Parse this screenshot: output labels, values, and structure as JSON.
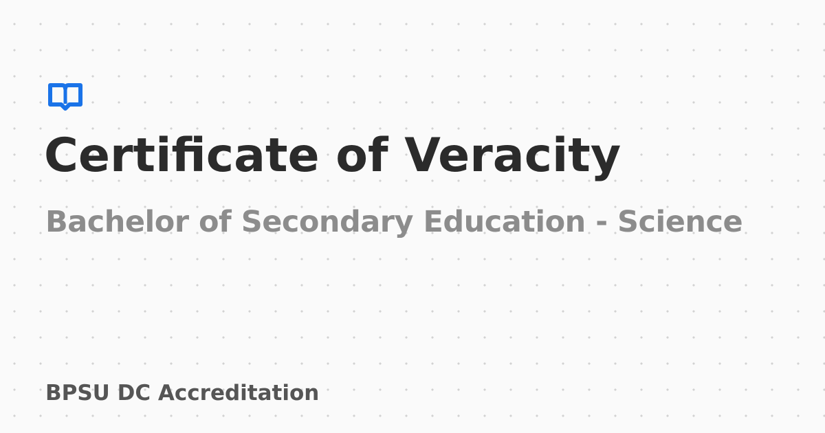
{
  "card": {
    "logo_icon": "open-book-icon",
    "accent_color": "#1a73e8",
    "title": "Certificate of Veracity",
    "subtitle": "Bachelor of Secondary Education - Science",
    "footer": "BPSU DC Accreditation"
  }
}
